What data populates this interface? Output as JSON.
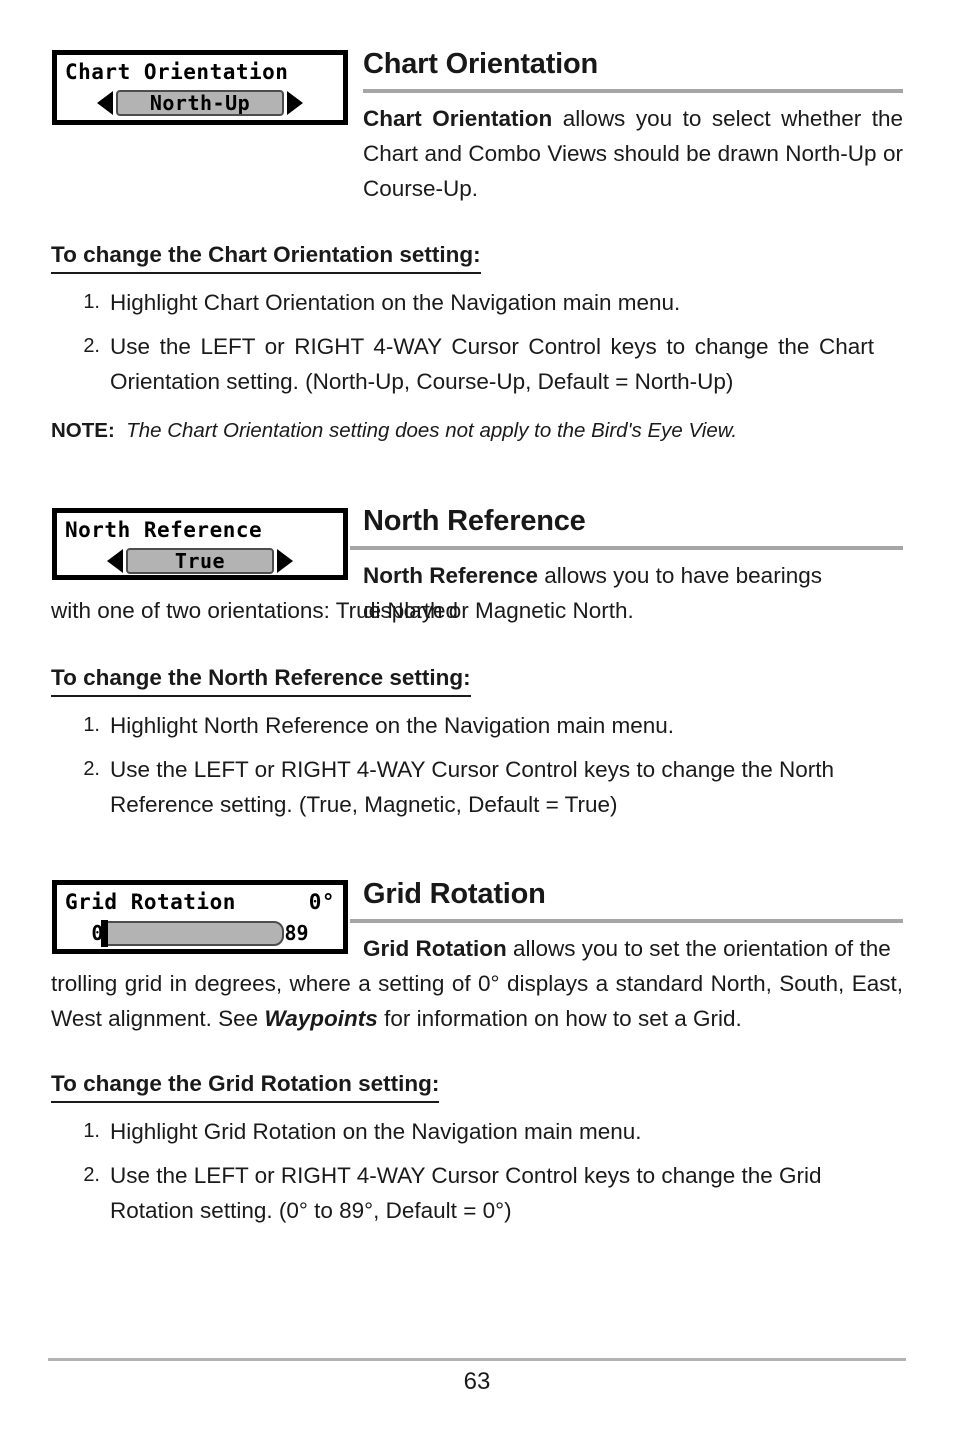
{
  "page": {
    "number": "63"
  },
  "sections": [
    {
      "id": "chart-orientation",
      "heading": "Chart Orientation",
      "widget": {
        "type": "selector",
        "title": "Chart Orientation",
        "value": "North-Up",
        "left_arrow": "left-arrow-icon",
        "right_arrow": "right-arrow-icon"
      },
      "intro": {
        "term": "Chart Orientation",
        "rest": " allows you to select whether the Chart and Combo Views should be drawn North-Up or Course-Up."
      },
      "sub_heading": "To change the Chart Orientation setting:",
      "steps": [
        {
          "num": "1.",
          "text": "Highlight Chart Orientation on the Navigation main menu."
        },
        {
          "num": "2.",
          "text": "Use the LEFT or RIGHT 4-WAY Cursor Control keys to change the Chart Orientation setting. (North-Up, Course-Up, Default = North-Up)"
        }
      ],
      "note": {
        "label": "NOTE:",
        "text": "The Chart Orientation setting does not apply to the Bird's Eye View."
      }
    },
    {
      "id": "north-reference",
      "heading": "North Reference",
      "widget": {
        "type": "selector",
        "title": "North Reference",
        "value": "True",
        "left_arrow": "left-arrow-icon",
        "right_arrow": "right-arrow-icon"
      },
      "intro": {
        "term": "North Reference",
        "rest_line1": " allows you to have bearings displayed",
        "rest_line2": "with one of two orientations: True North or Magnetic North."
      },
      "sub_heading": "To change the North Reference setting:",
      "steps": [
        {
          "num": "1.",
          "text": "Highlight North Reference on the Navigation main menu."
        },
        {
          "num": "2.",
          "text": "Use the LEFT or RIGHT 4-WAY Cursor Control keys to change the North Reference setting. (True, Magnetic, Default = True)"
        }
      ]
    },
    {
      "id": "grid-rotation",
      "heading": "Grid Rotation",
      "widget": {
        "type": "slider",
        "title": "Grid Rotation",
        "value": "0°",
        "min": "0",
        "max": "89",
        "fill_percent": 0
      },
      "intro": {
        "term": "Grid Rotation",
        "rest_line1": " allows you to set the orientation of the",
        "rest_line2_a": "trolling grid in degrees, where a setting of 0° displays a standard North, South, East, West alignment. See ",
        "emphasis": "Waypoints",
        "rest_line2_b": " for information on how to set a Grid."
      },
      "sub_heading": "To change the Grid Rotation setting:",
      "steps": [
        {
          "num": "1.",
          "text": "Highlight Grid Rotation on the Navigation main menu."
        },
        {
          "num": "2.",
          "text": "Use the LEFT or RIGHT 4-WAY Cursor Control keys to change the Grid Rotation setting. (0° to 89°, Default = 0°)"
        }
      ]
    }
  ],
  "colors": {
    "rule_gray": "#a6a6a6",
    "lcd_fill_gray": "#b3b3b3",
    "lcd_border": "#000000",
    "text": "#1a1a1a"
  }
}
